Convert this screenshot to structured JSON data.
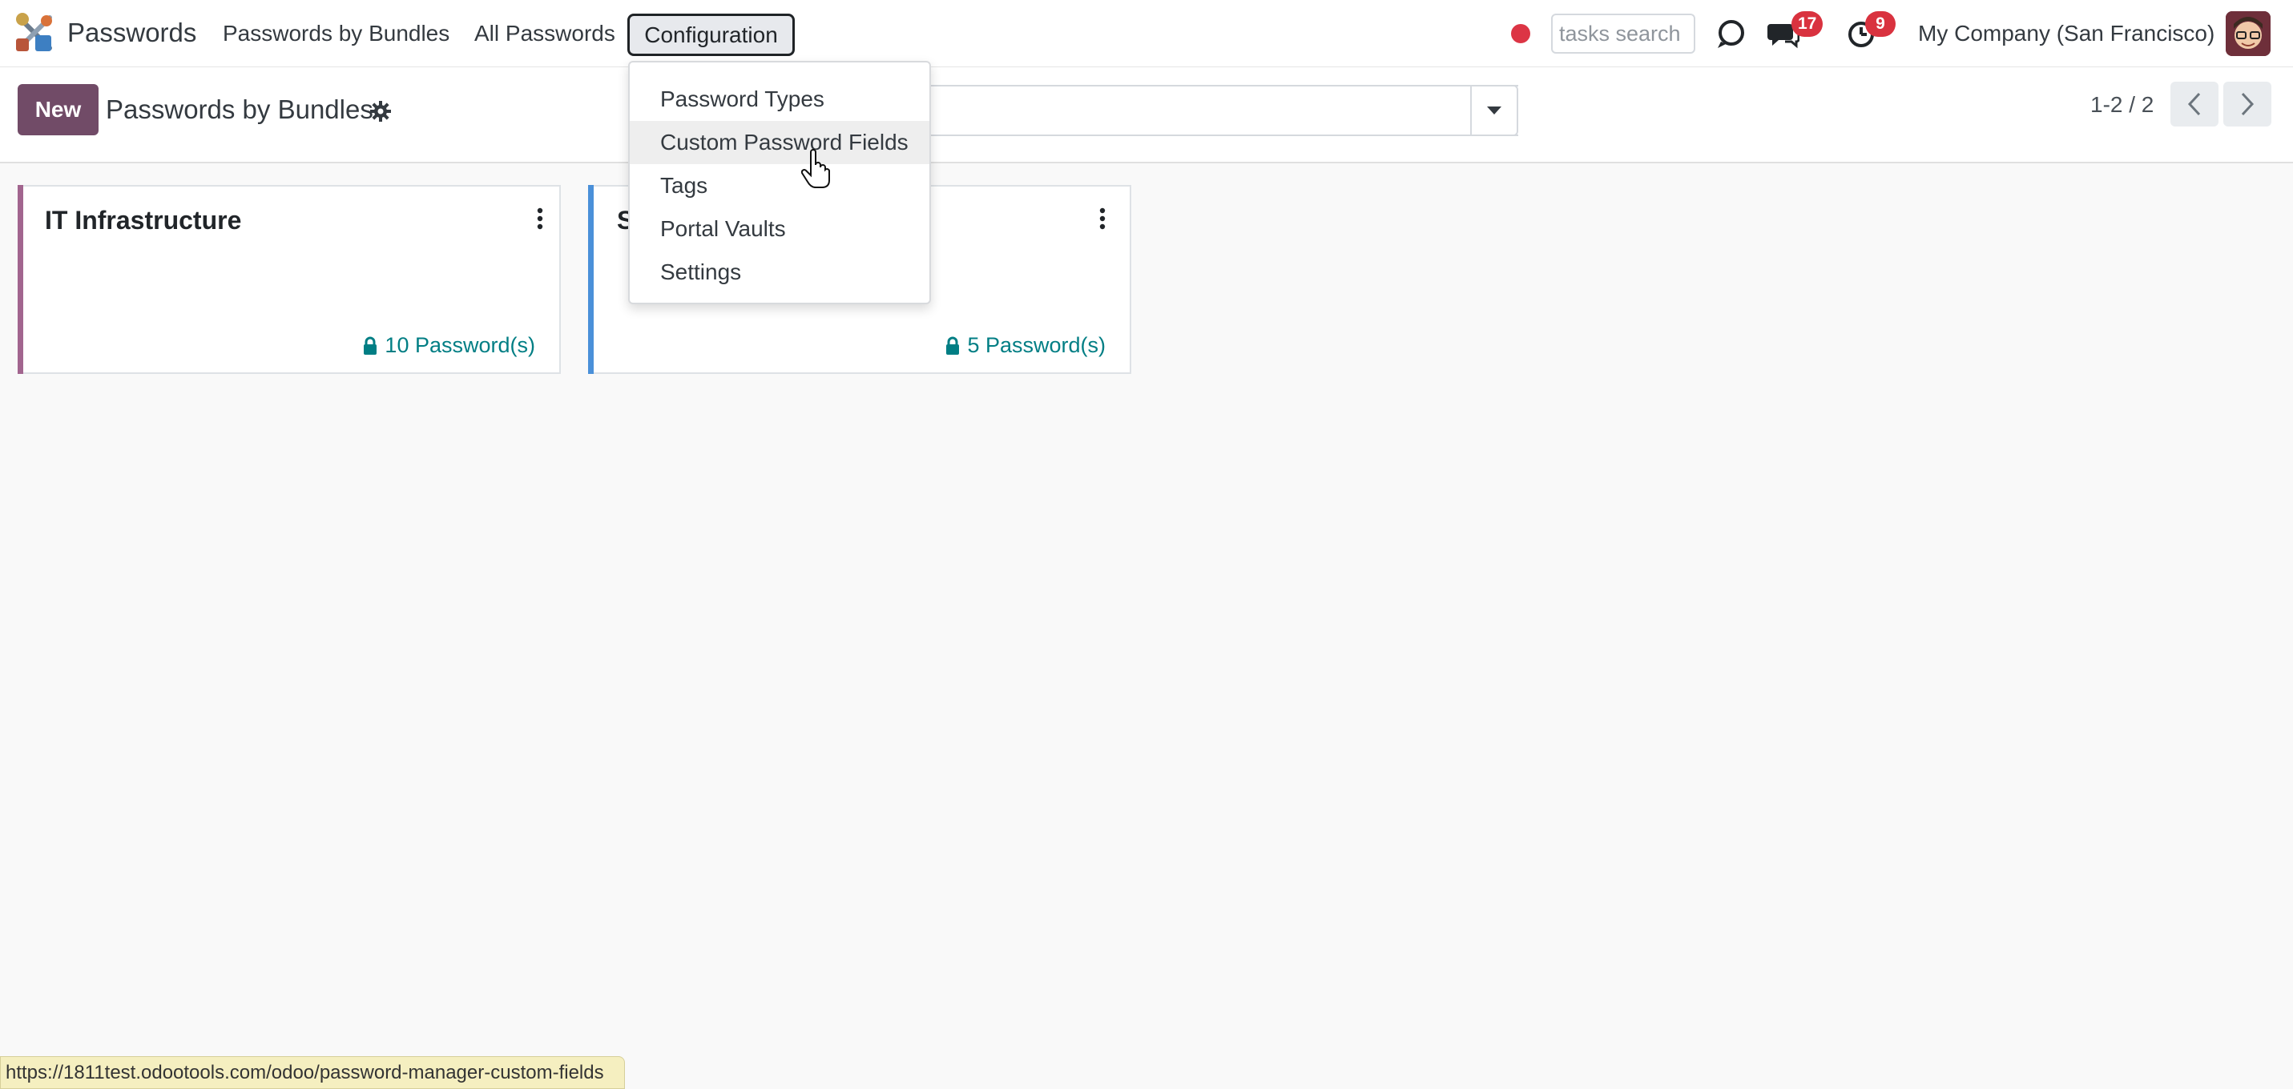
{
  "navbar": {
    "app_name": "Passwords",
    "menu": [
      {
        "label": "Passwords by Bundles"
      },
      {
        "label": "All Passwords"
      },
      {
        "label": "Configuration"
      }
    ],
    "tasks_search_placeholder": "tasks search",
    "messages_badge": "17",
    "activities_badge": "9",
    "company": "My Company (San Francisco)"
  },
  "control_panel": {
    "new_label": "New",
    "title": "Passwords by Bundles",
    "pager": "1-2 / 2"
  },
  "config_menu": {
    "items": [
      {
        "label": "Password Types"
      },
      {
        "label": "Custom Password Fields"
      },
      {
        "label": "Tags"
      },
      {
        "label": "Portal Vaults"
      },
      {
        "label": "Settings"
      }
    ],
    "hovered": "Custom Password Fields"
  },
  "kanban": {
    "cards": [
      {
        "title": "IT Infrastructure",
        "count": "10 Password(s)",
        "color": "#a2658f"
      },
      {
        "title": "S",
        "count": "5 Password(s)",
        "color": "#4a90d9"
      }
    ]
  },
  "status_url": "https://1811test.odootools.com/odoo/password-manager-custom-fields",
  "colors": {
    "primary": "#714b67",
    "link": "#017e84",
    "badge": "#d9323f"
  }
}
